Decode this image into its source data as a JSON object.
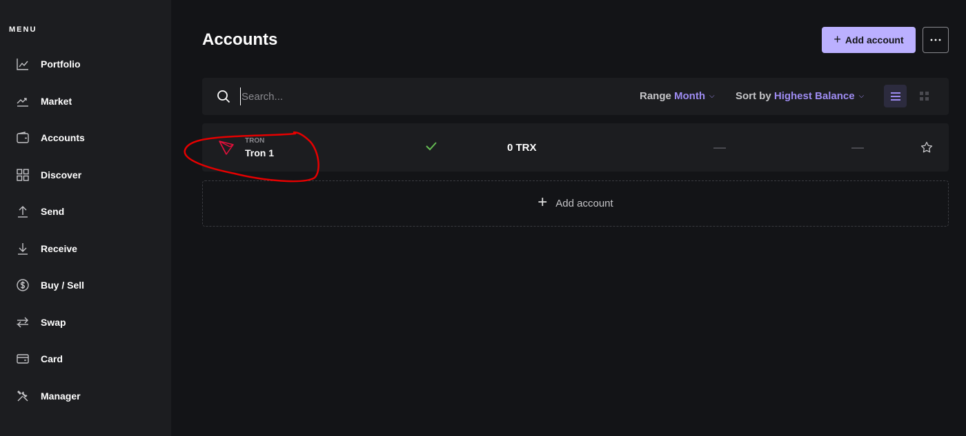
{
  "sidebar": {
    "title": "MENU",
    "items": [
      {
        "label": "Portfolio",
        "icon": "chart-line-icon"
      },
      {
        "label": "Market",
        "icon": "market-trend-icon"
      },
      {
        "label": "Accounts",
        "icon": "wallet-icon"
      },
      {
        "label": "Discover",
        "icon": "grid-icon"
      },
      {
        "label": "Send",
        "icon": "arrow-up-icon"
      },
      {
        "label": "Receive",
        "icon": "arrow-down-icon"
      },
      {
        "label": "Buy / Sell",
        "icon": "dollar-circle-icon"
      },
      {
        "label": "Swap",
        "icon": "swap-arrows-icon"
      },
      {
        "label": "Card",
        "icon": "card-icon"
      },
      {
        "label": "Manager",
        "icon": "tools-icon"
      }
    ]
  },
  "header": {
    "title": "Accounts",
    "add_account_label": "Add account"
  },
  "toolbar": {
    "search_placeholder": "Search...",
    "range_label": "Range",
    "range_value": "Month",
    "sort_label": "Sort by",
    "sort_value": "Highest Balance"
  },
  "accounts": [
    {
      "currency": "TRON",
      "name": "Tron 1",
      "balance": "0 TRX",
      "countervalue": "—",
      "variation": "—"
    }
  ],
  "add_account_row_label": "Add account",
  "colors": {
    "accent": "#bbb0ff",
    "accent_text": "#9e8cf2",
    "tron_red": "#e5103b",
    "sync_green": "#66be54",
    "annotation_red": "#e60000"
  }
}
